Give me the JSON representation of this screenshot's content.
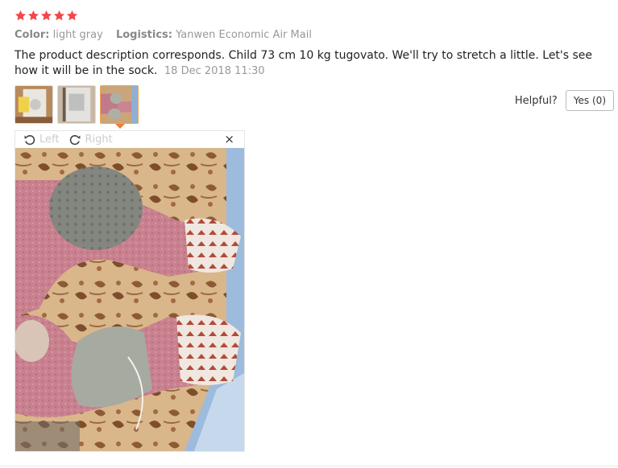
{
  "review": {
    "rating": 5,
    "star_color": "#f2484b",
    "color_label": "Color:",
    "color_value": "light gray",
    "logistics_label": "Logistics:",
    "logistics_value": "Yanwen Economic Air Mail",
    "text": "The product description corresponds. Child 73 cm 10 kg tugovato. We'll try to stretch a little. Let's see how it will be in the sock.",
    "date": "18 Dec 2018 11:30"
  },
  "thumbnails": [
    {
      "name": "photo-thumbnail-1",
      "active": false
    },
    {
      "name": "photo-thumbnail-2",
      "active": false
    },
    {
      "name": "photo-thumbnail-3",
      "active": true
    }
  ],
  "helpful": {
    "label": "Helpful?",
    "yes_label": "Yes (0)"
  },
  "viewer": {
    "rotate_left_label": "Left",
    "rotate_right_label": "Right",
    "close_glyph": "×",
    "icons": [
      "rotate-left-icon",
      "rotate-right-icon",
      "close-icon"
    ]
  },
  "colors": {
    "accent": "#f27b34",
    "active_thumb_border": "#f2a347"
  }
}
